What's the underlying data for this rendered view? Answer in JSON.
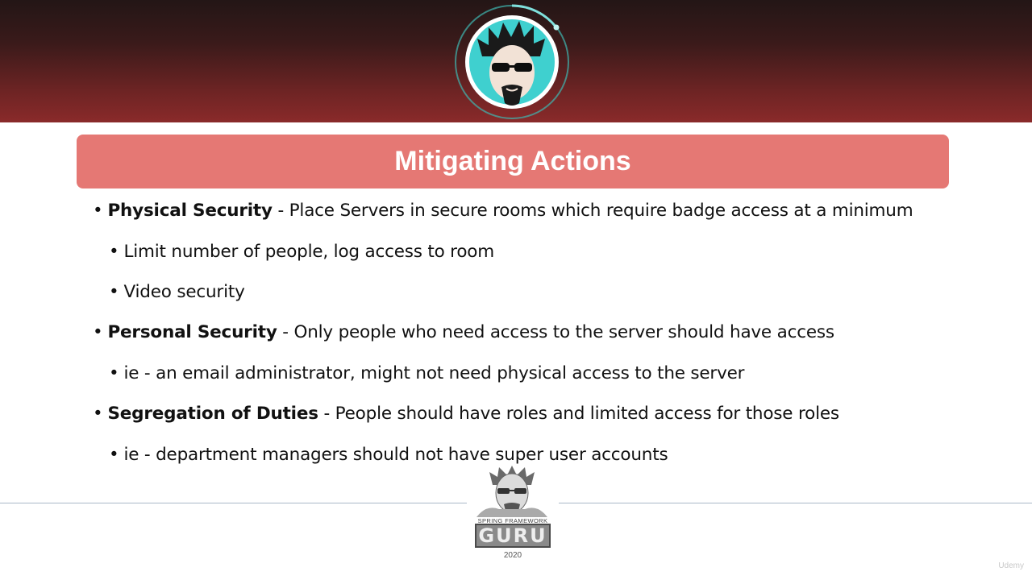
{
  "slide": {
    "title": "Mitigating Actions",
    "bullets": [
      {
        "level": 1,
        "term": "Physical Security",
        "text": " - Place Servers in secure rooms which require badge access at a minimum"
      },
      {
        "level": 2,
        "term": "",
        "text": "Limit number of people, log access to room"
      },
      {
        "level": 2,
        "term": "",
        "text": "Video security"
      },
      {
        "level": 1,
        "term": "Personal Security",
        "text": " - Only people who need access to the server should have access"
      },
      {
        "level": 2,
        "term": "",
        "text": "ie - an email administrator, might not need physical access to the server"
      },
      {
        "level": 1,
        "term": "Segregation of Duties",
        "text": " - People should have roles and limited access for those roles"
      },
      {
        "level": 2,
        "term": "",
        "text": "ie - department managers should not have super user accounts"
      }
    ]
  },
  "footer": {
    "tagline": "SPRING FRAMEWORK",
    "brand": "GURU",
    "year": "2020"
  },
  "watermark": "Udemy",
  "colors": {
    "title_bar": "#e57874",
    "header_dark": "#231616",
    "header_red": "#8a2a2a",
    "avatar_ring": "#3fb6b0"
  },
  "icons": {
    "header_avatar": "avatar-icon",
    "footer_logo": "guru-logo-icon"
  }
}
